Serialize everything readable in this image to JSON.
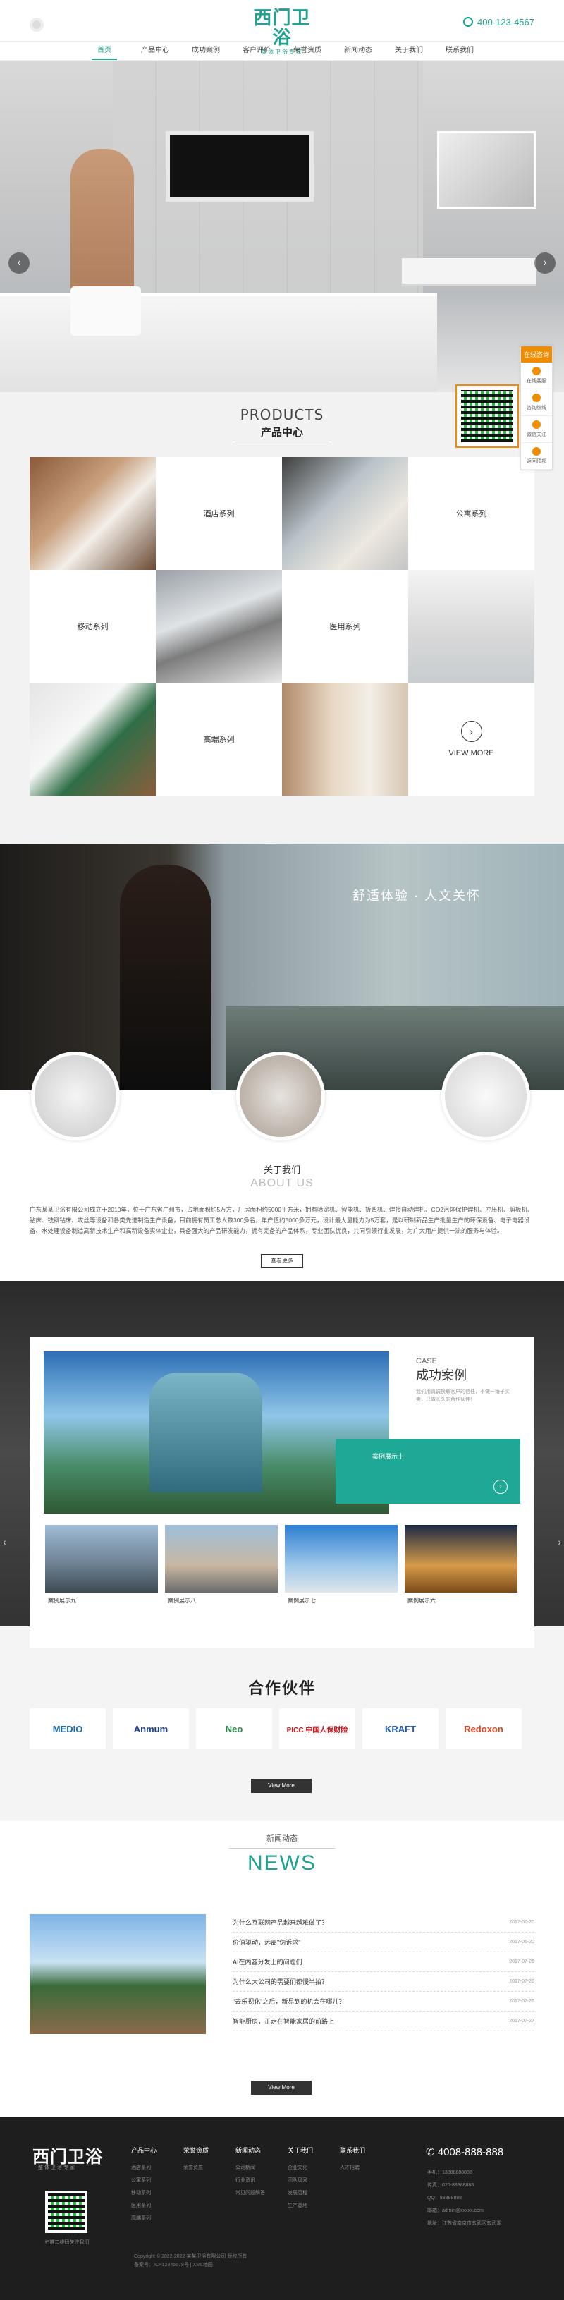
{
  "header": {
    "brand_title": "西门卫浴",
    "brand_sub": "整体卫浴专家",
    "phone": "400-123-4567"
  },
  "nav": [
    "首页",
    "产品中心",
    "成功案例",
    "客户评价",
    "荣誉资质",
    "新闻动态",
    "关于我们",
    "联系我们"
  ],
  "side_panel": {
    "head": "在线咨询",
    "items": [
      "在线客服",
      "咨询热线",
      "微信关注",
      "返回顶部"
    ]
  },
  "products": {
    "title_en": "PRODUCTS",
    "title_cn": "产品中心",
    "categories": [
      "酒店系列",
      "公寓系列",
      "移动系列",
      "医用系列",
      "高端系列"
    ],
    "view_more": "VIEW MORE"
  },
  "about": {
    "slogan": "舒适体验 · 人文关怀",
    "title_cn": "关于我们",
    "title_en": "ABOUT US",
    "text": "广东某某卫浴有限公司成立于2010年，位于广东省广州市，占地面积约5万方，厂房面积约5000平方米，拥有喷涂机、智能机、折弯机、焊接自动焊机、CO2汽体保护焊机、冲压机、剪板机、钻床、铣铆钻床、攻丝等设备和各类先进制造生产设备，目前拥有员工总人数300多名，年产值约5000多万元，设计最大量能力为5万套，是以研制新品生产批量生产的环保设备、电子电器设备、水处理设备制造高新技术生产和高新设备实体企业，具备强大的产品研发能力，拥有完备的产品体系，专业团队优良，共同引领行业发展，为广大用户提供一流的服务与体验。",
    "button": "查看更多"
  },
  "cases": {
    "en": "CASE",
    "cn": "成功案例",
    "desc": "我们用真诚换取客户的信任，不做一锤子买卖，只做长久的合作伙伴！",
    "featured": "案例展示十",
    "thumbs": [
      "案例展示九",
      "案例展示八",
      "案例展示七",
      "案例展示六"
    ]
  },
  "partners": {
    "title": "合作伙伴",
    "logos": [
      "MEDIO",
      "Anmum",
      "Neo",
      "PICC 中国人保财险",
      "KRAFT",
      "Redoxon"
    ],
    "button": "View More"
  },
  "news": {
    "cn": "新闻动态",
    "en": "NEWS",
    "items": [
      {
        "title": "为什么互联网产品越来越难做了？",
        "date": "2017-06-20"
      },
      {
        "title": "价值驱动，远离\"伪诉求\"",
        "date": "2017-06-20"
      },
      {
        "title": "AI在内容分发上的问题们",
        "date": "2017-07-26"
      },
      {
        "title": "为什么大公司的需要们都慢半拍？",
        "date": "2017-07-26"
      },
      {
        "title": "\"去乐视化\"之后，新易到的机会在哪儿？",
        "date": "2017-07-26"
      },
      {
        "title": "智能厨房，正走在智能家居的前路上",
        "date": "2017-07-27"
      }
    ],
    "button": "View More"
  },
  "footer": {
    "logo": "西门卫浴",
    "logo_sub": "整体卫浴专家",
    "qr_caption": "扫描二维码关注我们",
    "columns": [
      {
        "head": "产品中心",
        "items": [
          "酒店系列",
          "公寓系列",
          "移动系列",
          "医用系列",
          "高端系列"
        ]
      },
      {
        "head": "荣誉资质",
        "items": [
          "荣誉资质"
        ]
      },
      {
        "head": "新闻动态",
        "items": [
          "公司新闻",
          "行业资讯",
          "常见问题解答"
        ]
      },
      {
        "head": "关于我们",
        "items": [
          "企业文化",
          "团队风采",
          "发展历程",
          "生产基地"
        ]
      },
      {
        "head": "联系我们",
        "items": [
          "人才招聘"
        ]
      }
    ],
    "phone": "4008-888-888",
    "info": [
      "手机：13888888888",
      "传真：020-88888888",
      "QQ：88888888",
      "邮箱：admin@xxxxx.com",
      "地址：江苏省南京市玄武区玄武湖"
    ],
    "copyright": "Copyright © 2022-2022 某某卫浴有限公司 版权所有",
    "icp": "备案号：ICP12345678号 | XML地图"
  }
}
